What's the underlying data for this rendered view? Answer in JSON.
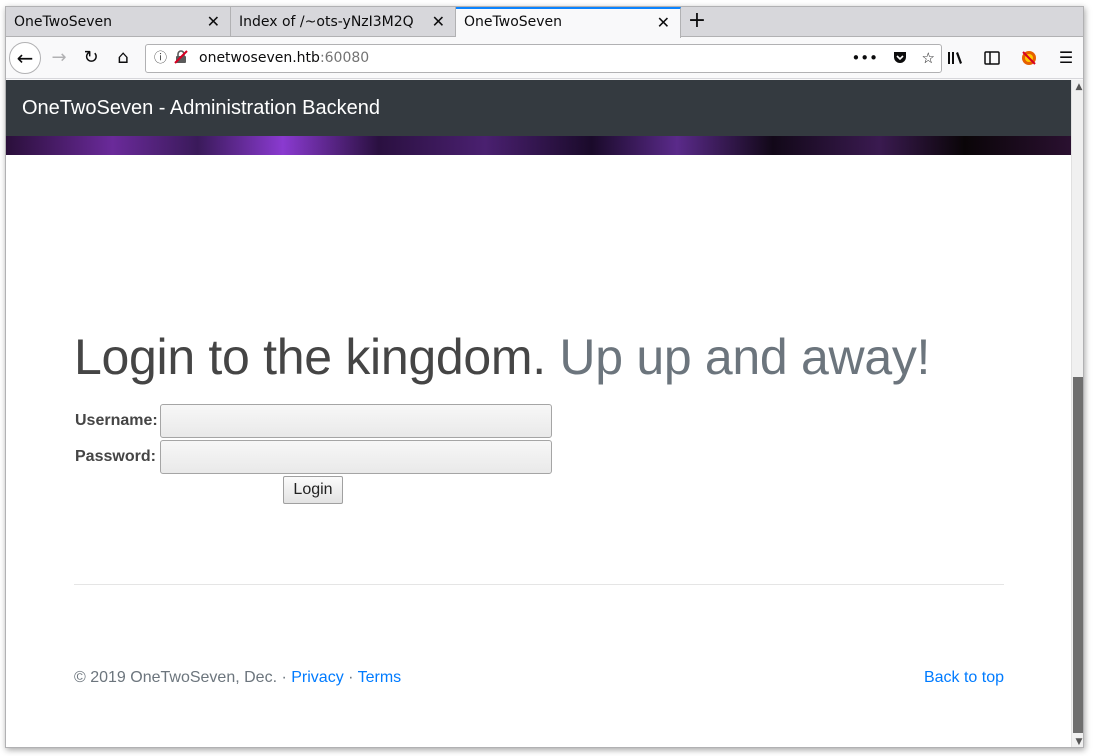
{
  "browser": {
    "tabs": [
      {
        "title": "OneTwoSeven",
        "close": "✕"
      },
      {
        "title": "Index of /~ots-yNzI3M2Q",
        "close": "✕"
      },
      {
        "title": "OneTwoSeven",
        "close": "✕"
      }
    ],
    "new_tab": "+",
    "url_host": "onetwoseven.htb",
    "url_port": ":60080",
    "page_actions": "•••"
  },
  "site": {
    "brand": "OneTwoSeven - Administration Backend",
    "heading_main": "Login to the kingdom.",
    "heading_muted": "Up up and away!",
    "username_label": "Username:",
    "password_label": "Password:",
    "login_button": "Login",
    "copyright": "© 2019 OneTwoSeven, Dec. · ",
    "privacy_link": "Privacy",
    "separator": " · ",
    "terms_link": "Terms",
    "back_to_top": "Back to top"
  },
  "colors": {
    "header_bg": "#343a40",
    "link": "#007bff",
    "active_tab_accent": "#0a84ff"
  }
}
